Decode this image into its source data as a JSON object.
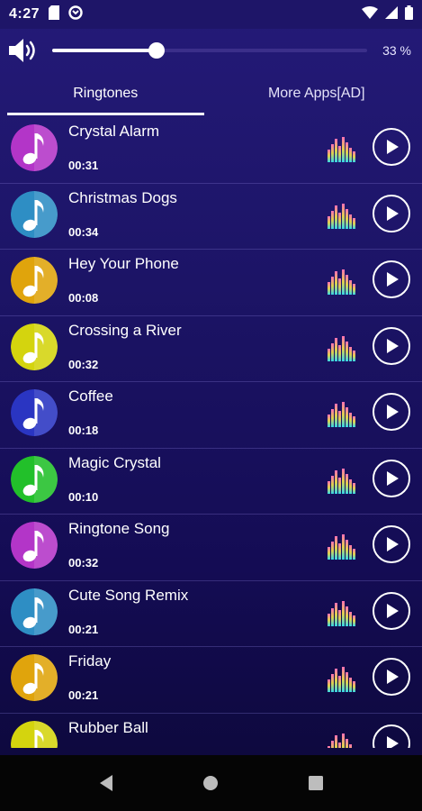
{
  "status_bar": {
    "time": "4:27",
    "icons": [
      "sd-card-icon",
      "sync-icon",
      "wifi-icon",
      "signal-icon",
      "battery-icon"
    ]
  },
  "volume": {
    "percent_label": "33 %",
    "level": 0.33
  },
  "tabs": [
    {
      "label": "Ringtones",
      "active": true
    },
    {
      "label": "More Apps[AD]",
      "active": false
    }
  ],
  "ringtones": [
    {
      "title": "Crystal Alarm",
      "duration": "00:31",
      "color": "#b335c8"
    },
    {
      "title": "Christmas Dogs",
      "duration": "00:34",
      "color": "#2e8ec4"
    },
    {
      "title": "Hey Your Phone",
      "duration": "00:08",
      "color": "#e0a40c"
    },
    {
      "title": "Crossing a River",
      "duration": "00:32",
      "color": "#d4d40e"
    },
    {
      "title": "Coffee",
      "duration": "00:18",
      "color": "#2a35c2"
    },
    {
      "title": "Magic Crystal",
      "duration": "00:10",
      "color": "#22c02a"
    },
    {
      "title": "Ringtone Song",
      "duration": "00:32",
      "color": "#b335c8"
    },
    {
      "title": "Cute Song Remix",
      "duration": "00:21",
      "color": "#2e8ec4"
    },
    {
      "title": "Friday",
      "duration": "00:21",
      "color": "#e0a40c"
    },
    {
      "title": "Rubber Ball",
      "duration": "",
      "color": "#d4d40e"
    }
  ],
  "nav": {
    "buttons": [
      "back-icon",
      "home-icon",
      "recents-icon"
    ]
  }
}
